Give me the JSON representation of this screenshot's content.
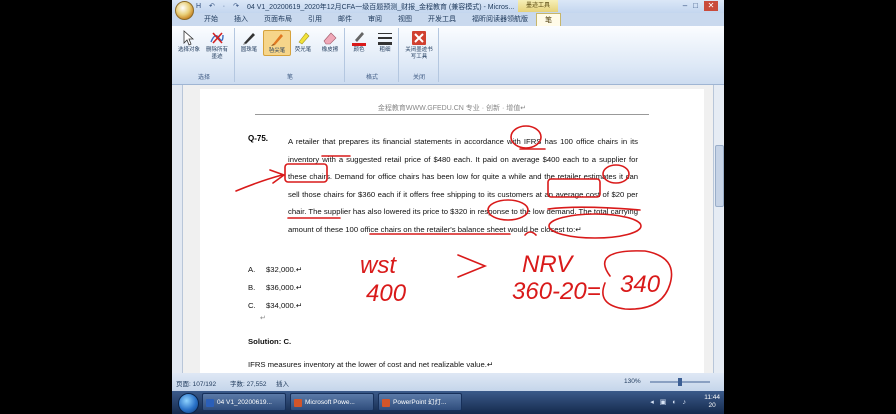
{
  "window": {
    "title": "04 V1_20200619_2020年12月CFA一级百题预测_财报_金程教育 (兼容模式) - Micros...",
    "context_tab": "墨迹工具",
    "quick_access": "H ↶ · ↷ ·"
  },
  "ribbon": {
    "tabs": [
      "开始",
      "插入",
      "页面布局",
      "引用",
      "邮件",
      "审阅",
      "视图",
      "开发工具",
      "福昕阅读器领航版",
      "笔"
    ],
    "active_tab": "笔",
    "groups": [
      {
        "label": "选择",
        "buttons": [
          "选择对象",
          "删除所有墨迹"
        ]
      },
      {
        "label": "笔",
        "buttons": [
          "圆珠笔",
          "毡尖笔",
          "荧光笔",
          "橡皮擦"
        ]
      },
      {
        "label": "格式",
        "buttons": [
          "颜色",
          "粗细"
        ]
      },
      {
        "label": "关闭",
        "buttons": [
          "关闭墨迹书写工具"
        ]
      }
    ]
  },
  "document": {
    "header": "金程教育WWW.GFEDU.CN 专业 · 创新 · 增值↵",
    "question_number": "Q-75.",
    "question_text": "A retailer that prepares its financial statements in accordance with IFRS has 100 office chairs in its inventory with a suggested retail price of $480 each. It paid on average $400 each to a supplier for these chairs. Demand for office chairs has been low for quite a while and the retailer estimates it can sell those chairs for $360 each if it offers free shipping to its customers at an average cost of $20 per chair. The supplier has also lowered its price to $320 in response to the low demand. The total carrying amount of these 100 office chairs on the retailer's balance sheet would be closest to:↵",
    "options": [
      {
        "letter": "A.",
        "value": "$32,000.↵"
      },
      {
        "letter": "B.",
        "value": "$36,000.↵"
      },
      {
        "letter": "C.",
        "value": "$34,000.↵"
      }
    ],
    "empty_paragraph": "↵",
    "solution": "Solution: C.",
    "explanation": "IFRS measures inventory at the lower of cost and net realizable value.↵"
  },
  "annotations": {
    "cost_label": "wst",
    "cost_value": "400",
    "nrv_label": "NRV",
    "nrv_calc": "360-20=",
    "nrv_result": "340",
    "ink_color": "#d91a1a"
  },
  "statusbar": {
    "page": "页面: 107/192",
    "words": "字数: 27,552",
    "mode": "插入",
    "zoom": "130%",
    "zoom_fraction": 0.5
  },
  "taskbar": {
    "tasks": [
      "04 V1_20200619...",
      "Microsoft Powe...",
      "PowerPoint 幻灯..."
    ],
    "time": "11:44",
    "date": "20"
  }
}
